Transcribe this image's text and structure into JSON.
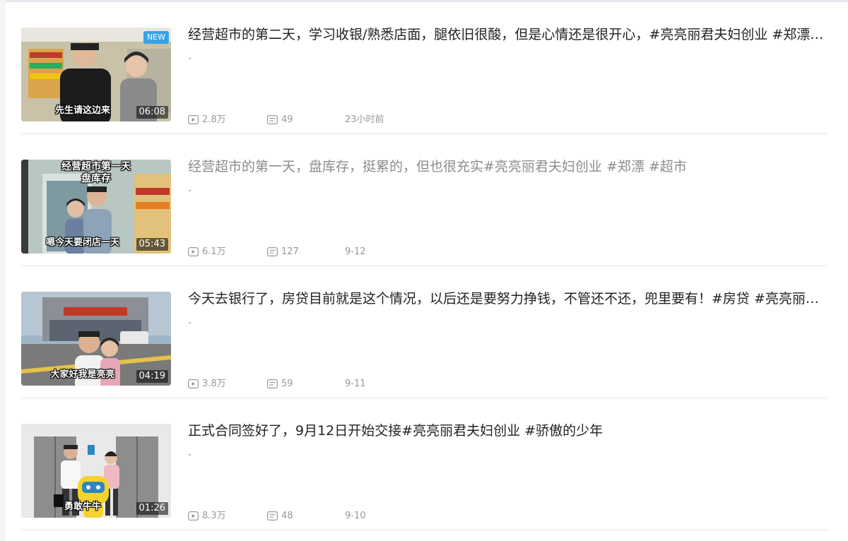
{
  "videos": [
    {
      "title": "经营超市的第二天，学习收银/熟悉店面，腿依旧很酸，但是心情还是很开心，#亮亮丽君夫妇创业 #郑漂 #超市",
      "desc": "-",
      "views": "2.8万",
      "comments": "49",
      "date": "23小时前",
      "duration": "06:08",
      "badge": "NEW",
      "caption": "先生请这边来",
      "overlay": "",
      "visited": false
    },
    {
      "title": "经营超市的第一天，盘库存，挺累的，但也很充实#亮亮丽君夫妇创业 #郑漂 #超市",
      "desc": "-",
      "views": "6.1万",
      "comments": "127",
      "date": "9-12",
      "duration": "05:43",
      "badge": "",
      "caption": "嗯今天要闭店一天",
      "overlay": "经营超市第一天\n盘库存",
      "visited": true
    },
    {
      "title": "今天去银行了，房贷目前就是这个情况，以后还是要努力挣钱，不管还不还，兜里要有！#房贷 #亮亮丽君夫妇创业",
      "desc": "-",
      "views": "3.8万",
      "comments": "59",
      "date": "9-11",
      "duration": "04:19",
      "badge": "",
      "caption": "大家好我是亮亮",
      "overlay": "",
      "visited": false
    },
    {
      "title": "正式合同签好了，9月12日开始交接#亮亮丽君夫妇创业 #骄傲的少年",
      "desc": "-",
      "views": "8.3万",
      "comments": "48",
      "date": "9-10",
      "duration": "01:26",
      "badge": "",
      "caption": "勇敢牛牛",
      "overlay": "",
      "visited": false
    }
  ],
  "icons": {
    "views": "play-icon",
    "comments": "comment-icon"
  },
  "colors": {
    "title": "#222222",
    "title_visited": "#8c8c8c",
    "meta": "#999999",
    "badge": "#35a3e8"
  }
}
